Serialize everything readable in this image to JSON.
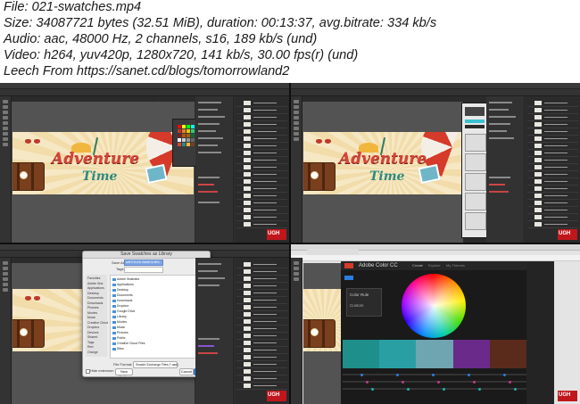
{
  "header": {
    "lines": [
      "File: 021-swatches.mp4",
      "Size: 34087721 bytes (32.51 MiB), duration: 00:13:37, avg.bitrate: 334 kb/s",
      "Audio: aac, 48000 Hz, 2 channels, s16, 189 kb/s (und)",
      "Video: h264, yuv420p, 1280x720, 141 kb/s, 30.00 fps(r) (und)",
      "Leech From https://sanet.cd/blogs/tomorrowland2"
    ]
  },
  "artwork": {
    "title_word1": "Adventure",
    "title_word2": "Time"
  },
  "watermark": {
    "label": "UGH"
  },
  "save_dialog": {
    "title": "Save Swatches as Library",
    "save_as_label": "Save As:",
    "save_as_value": "UNTITLED SWATCHES",
    "tags_label": "Tags:",
    "sidebar": [
      "Favorites",
      "Adobe Illus",
      "Applications",
      "Desktop",
      "Documents",
      "Downloads",
      "Pictures",
      "Movies",
      "Music",
      "Creative Cloud",
      "Dropbox",
      "Devices",
      "Shared",
      "Tags",
      "Red",
      "Orange"
    ],
    "files": [
      "Adobe Illustrator",
      "Applications",
      "Desktop",
      "Documents",
      "Downloads",
      "Dropbox",
      "Google Drive",
      "Library",
      "Movies",
      "Music",
      "Pictures",
      "Public",
      "Creative Cloud Files",
      "Sites"
    ],
    "format_label": "File Format:",
    "format_value": "Swatch Exchange Files (*.ase)",
    "new_folder": "New Folder",
    "hide_extension": "Hide extension",
    "cancel": "Cancel",
    "save": "Save"
  },
  "adobe_color": {
    "app_title": "Adobe Color CC",
    "nav": [
      "Create",
      "Explore",
      "My Themes"
    ],
    "rule_label": "Color Rule",
    "rule_value": "Custom",
    "swatches": [
      "#1e8f8a",
      "#2a9fa3",
      "#6fa5b0",
      "#6a2a8a",
      "#5a2b1a"
    ],
    "slider_colors": [
      "#2a7fe0",
      "#c03a8a",
      "#20b0b0"
    ]
  },
  "colors": {
    "swatch_panel": [
      "#ff0000",
      "#ffff00",
      "#00ff00",
      "#00ffff",
      "#0000ff",
      "#ff00ff",
      "#c0392b",
      "#e67e22",
      "#f1c40f",
      "#2ecc71",
      "#3498db",
      "#9b59b6",
      "#7f1d1d",
      "#b45309",
      "#a16207",
      "#166534",
      "#1e3a8a",
      "#581c87",
      "#ffffff",
      "#cccccc",
      "#999999",
      "#666666",
      "#333333",
      "#000000",
      "#d8443a",
      "#2c8a7e",
      "#f1b63d",
      "#7a3f1d",
      "#6fb6c8",
      "#f5e6bf"
    ]
  }
}
